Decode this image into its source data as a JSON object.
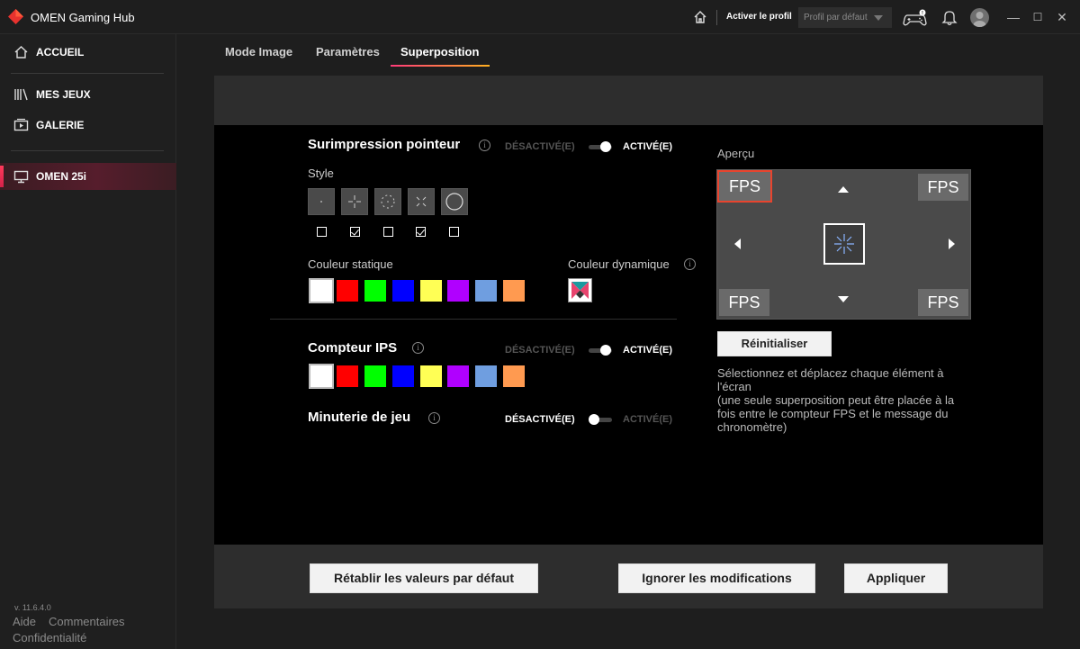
{
  "titlebar": {
    "app_title": "OMEN Gaming Hub",
    "activate_profile": "Activer le profil",
    "profile_select": "Profil par défaut",
    "window_buttons": [
      "—",
      "☐",
      "✕"
    ]
  },
  "sidebar": {
    "items": [
      {
        "label": "ACCUEIL",
        "icon": "home-icon"
      },
      {
        "label": "MES JEUX",
        "icon": "library-icon"
      },
      {
        "label": "GALERIE",
        "icon": "gallery-icon"
      },
      {
        "label": "OMEN 25i",
        "icon": "monitor-icon",
        "active": true
      }
    ],
    "version": "v. 11.6.4.0",
    "links": {
      "help": "Aide",
      "comments": "Commentaires",
      "privacy": "Confidentialité"
    }
  },
  "tabs": [
    {
      "label": "Mode Image"
    },
    {
      "label": "Paramètres"
    },
    {
      "label": "Superposition",
      "active": true
    }
  ],
  "crosshair": {
    "title": "Surimpression pointeur",
    "off_label": "DÉSACTIVÉ(E)",
    "on_label": "ACTIVÉ(E)",
    "enabled": true,
    "style_label": "Style",
    "styles": [
      {
        "icon": "dot-crosshair-icon",
        "checked": false
      },
      {
        "icon": "cross-crosshair-icon",
        "checked": true
      },
      {
        "icon": "circle-dot-crosshair-icon",
        "checked": false
      },
      {
        "icon": "x-crosshair-icon",
        "checked": true
      },
      {
        "icon": "ring-crosshair-icon",
        "checked": false
      }
    ],
    "static_color_label": "Couleur statique",
    "dynamic_color_label": "Couleur dynamique",
    "colors": [
      "#ffffff",
      "#ff0000",
      "#00ff00",
      "#0000ff",
      "#ffff55",
      "#b000ff",
      "#6f9ee0",
      "#ff9a50"
    ],
    "selected_color": "#ffffff"
  },
  "fps_counter": {
    "title": "Compteur IPS",
    "off_label": "DÉSACTIVÉ(E)",
    "on_label": "ACTIVÉ(E)",
    "enabled": true,
    "colors": [
      "#ffffff",
      "#ff0000",
      "#00ff00",
      "#0000ff",
      "#ffff55",
      "#b000ff",
      "#6f9ee0",
      "#ff9a50"
    ],
    "selected_color": "#ffffff"
  },
  "game_timer": {
    "title": "Minuterie de jeu",
    "off_label": "DÉSACTIVÉ(E)",
    "on_label": "ACTIVÉ(E)",
    "enabled": false
  },
  "preview": {
    "label": "Aperçu",
    "fps_text": "FPS",
    "reset_button": "Réinitialiser",
    "help_text": "Sélectionnez et déplacez chaque élément à l'écran\n(une seule superposition peut être placée à la fois entre le compteur FPS et le message du chronomètre)"
  },
  "footer": {
    "restore_defaults": "Rétablir les valeurs par défaut",
    "ignore_changes": "Ignorer les modifications",
    "apply": "Appliquer"
  }
}
